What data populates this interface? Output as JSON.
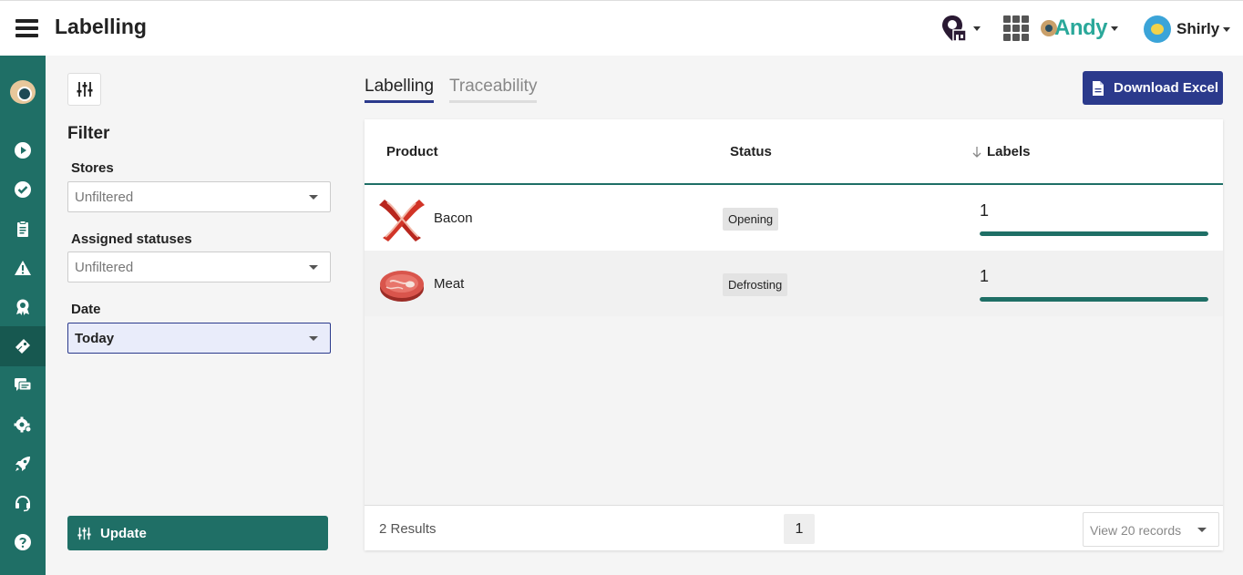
{
  "header": {
    "title": "Labelling",
    "brand": "Andy",
    "user_name": "Shirly"
  },
  "sidebar": {
    "items": [
      {
        "icon": "play-icon"
      },
      {
        "icon": "check-circle-icon"
      },
      {
        "icon": "clipboard-icon"
      },
      {
        "icon": "warning-icon"
      },
      {
        "icon": "award-icon"
      },
      {
        "icon": "label-tag-icon",
        "active": true
      },
      {
        "icon": "chat-icon"
      },
      {
        "icon": "settings-icon"
      },
      {
        "icon": "rocket-icon"
      },
      {
        "icon": "headset-icon"
      },
      {
        "icon": "help-icon"
      }
    ]
  },
  "filter": {
    "title": "Filter",
    "stores_label": "Stores",
    "stores_value": "Unfiltered",
    "statuses_label": "Assigned statuses",
    "statuses_value": "Unfiltered",
    "date_label": "Date",
    "date_value": "Today",
    "update_label": "Update"
  },
  "tabs": [
    {
      "label": "Labelling",
      "active": true
    },
    {
      "label": "Traceability",
      "active": false
    }
  ],
  "download_label": "Download Excel",
  "table": {
    "columns": [
      "Product",
      "Status",
      "Labels"
    ],
    "rows": [
      {
        "product": "Bacon",
        "status": "Opening",
        "labels": "1",
        "progress": 1.0
      },
      {
        "product": "Meat",
        "status": "Defrosting",
        "labels": "1",
        "progress": 1.0
      }
    ],
    "results": "2 Results",
    "page": "1",
    "view_records": "View 20 records"
  },
  "colors": {
    "primary": "#1f6f66",
    "accent": "#2b3a8c"
  }
}
